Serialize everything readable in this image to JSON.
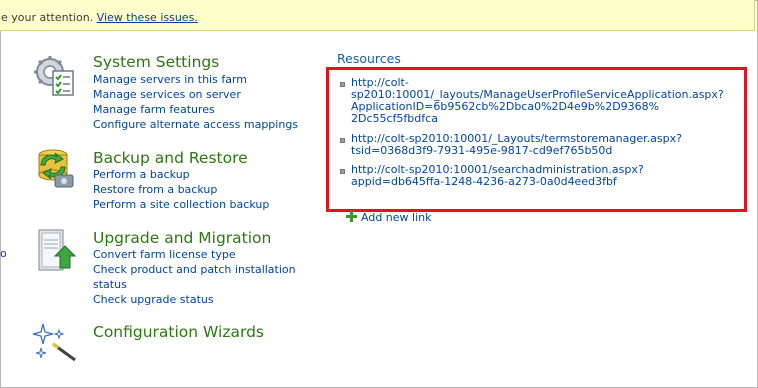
{
  "warning": {
    "text": "e your attention. ",
    "link": "View these issues."
  },
  "left_fragment": "o",
  "sections": [
    {
      "title": "System Settings",
      "links": [
        "Manage servers in this farm",
        "Manage services on server",
        "Manage farm features",
        "Configure alternate access mappings"
      ]
    },
    {
      "title": "Backup and Restore",
      "links": [
        "Perform a backup",
        "Restore from a backup",
        "Perform a site collection backup"
      ]
    },
    {
      "title": "Upgrade and Migration",
      "links": [
        "Convert farm license type",
        "Check product and patch installation",
        "status",
        "Check upgrade status"
      ]
    },
    {
      "title": "Configuration Wizards",
      "links": []
    }
  ],
  "resources": {
    "title": "Resources",
    "items": [
      {
        "lines": [
          "http://colt-",
          "sp2010:10001/_layouts/ManageUserProfileServiceApplication.aspx?",
          "ApplicationID=6b9562cb%2Dbca0%2D4e9b%2D9368%",
          "2Dc55cf5fbdfca"
        ]
      },
      {
        "lines": [
          "http://colt-sp2010:10001/_Layouts/termstoremanager.aspx?",
          "tsid=0368d3f9-7931-495e-9817-cd9ef765b50d"
        ]
      },
      {
        "lines": [
          "http://colt-sp2010:10001/searchadministration.aspx?",
          "appid=db645ffa-1248-4236-a273-0a0d4eed3fbf"
        ]
      }
    ],
    "add_new_link": "Add new link"
  },
  "colors": {
    "heading": "#2b7a10",
    "link": "#0046a6",
    "highlight_box": "#e1131c",
    "warning_bg": "#ffffcc"
  },
  "icons": [
    "gear-checklist-icon",
    "backup-restore-icon",
    "upgrade-server-icon",
    "wizard-wand-icon",
    "plus-icon"
  ]
}
